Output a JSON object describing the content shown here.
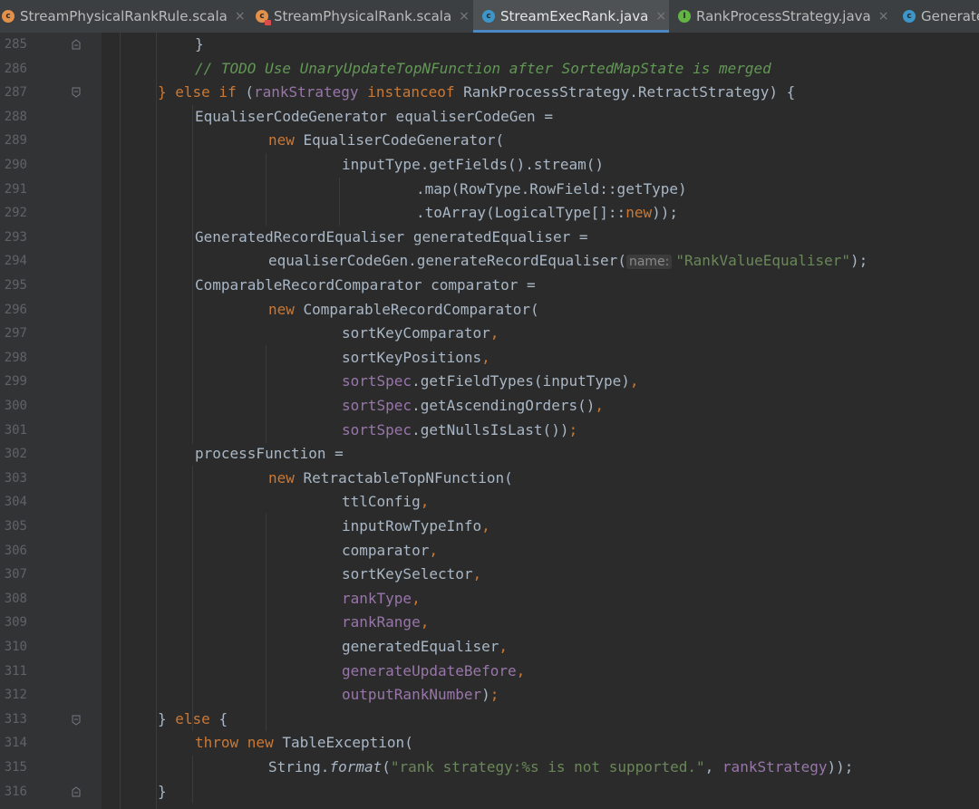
{
  "tabs": [
    {
      "label": "StreamPhysicalRankRule.scala",
      "icon": "scala-class-icon",
      "active": false
    },
    {
      "label": "StreamPhysicalRank.scala",
      "icon": "scala-class-locked-icon",
      "active": false
    },
    {
      "label": "StreamExecRank.java",
      "icon": "java-class-icon",
      "active": true
    },
    {
      "label": "RankProcessStrategy.java",
      "icon": "interface-icon",
      "active": false
    },
    {
      "label": "Generate",
      "icon": "java-class-icon",
      "active": false
    }
  ],
  "close_glyph": "×",
  "line_numbers": [
    "285",
    "286",
    "287",
    "288",
    "289",
    "290",
    "291",
    "292",
    "293",
    "294",
    "295",
    "296",
    "297",
    "298",
    "299",
    "300",
    "301",
    "302",
    "303",
    "304",
    "305",
    "306",
    "307",
    "308",
    "309",
    "310",
    "311",
    "312",
    "313",
    "314",
    "315",
    "316"
  ],
  "code": {
    "l285": {
      "t1": "}"
    },
    "l286": {
      "t1": "// TODO Use UnaryUpdateTopNFunction after SortedMapState is merged"
    },
    "l287": {
      "t1": "} ",
      "t2": "else if ",
      "t3": "(",
      "t4": "rankStrategy ",
      "t5": "instanceof ",
      "t6": "RankProcessStrategy.RetractStrategy) {"
    },
    "l288": {
      "t1": "EqualiserCodeGenerator equaliserCodeGen ="
    },
    "l289": {
      "t1": "new ",
      "t2": "EqualiserCodeGenerator("
    },
    "l290": {
      "t1": "inputType.getFields().stream()"
    },
    "l291": {
      "t1": ".map(RowType.RowField::getType)"
    },
    "l292": {
      "t1": ".toArray(LogicalType[]::",
      "t2": "new",
      "t3": "));"
    },
    "l293": {
      "t1": "GeneratedRecordEqualiser generatedEqualiser ="
    },
    "l294": {
      "t1": "equaliserCodeGen.generateRecordEqualiser(",
      "hint": "name:",
      "t2": "\"RankValueEqualiser\"",
      "t3": ");"
    },
    "l295": {
      "t1": "ComparableRecordComparator comparator ="
    },
    "l296": {
      "t1": "new ",
      "t2": "ComparableRecordComparator("
    },
    "l297": {
      "t1": "sortKeyComparator",
      ",": ","
    },
    "l298": {
      "t1": "sortKeyPositions",
      ",": ","
    },
    "l299": {
      "t1": "sortSpec",
      ".": ".getFieldTypes(inputType)",
      ",": ","
    },
    "l300": {
      "t1": "sortSpec",
      ".": ".getAscendingOrders()",
      ",": ","
    },
    "l301": {
      "t1": "sortSpec",
      ".": ".getNullsIsLast())",
      ",": ";"
    },
    "l302": {
      "t1": "processFunction ="
    },
    "l303": {
      "t1": "new ",
      "t2": "RetractableTopNFunction("
    },
    "l304": {
      "t1": "ttlConfig",
      ",": ","
    },
    "l305": {
      "t1": "inputRowTypeInfo",
      ",": ","
    },
    "l306": {
      "t1": "comparator",
      ",": ","
    },
    "l307": {
      "t1": "sortKeySelector",
      ",": ","
    },
    "l308": {
      "t1": "rankType",
      ",": ","
    },
    "l309": {
      "t1": "rankRange",
      ",": ","
    },
    "l310": {
      "t1": "generatedEqualiser",
      ",": ","
    },
    "l311": {
      "t1": "generateUpdateBefore",
      ",": ","
    },
    "l312": {
      "t1": "outputRankNumber",
      ")": ")",
      ",": ";"
    },
    "l313": {
      "t1": "} ",
      "t2": "else ",
      "t3": "{"
    },
    "l314": {
      "t1": "throw new ",
      "t2": "TableException("
    },
    "l315": {
      "t1": "String.",
      "t2": "format",
      "t3": "(",
      "t4": "\"rank strategy:%s is not supported.\"",
      "t5": ", ",
      "t6": "rankStrategy",
      "t7": "));"
    },
    "l316": {
      "t1": "}"
    }
  },
  "colors": {
    "background": "#2b2b2b",
    "keyword": "#cc7832",
    "field": "#9876aa",
    "string": "#6a8759",
    "comment": "#629755",
    "text": "#a9b7c6"
  }
}
